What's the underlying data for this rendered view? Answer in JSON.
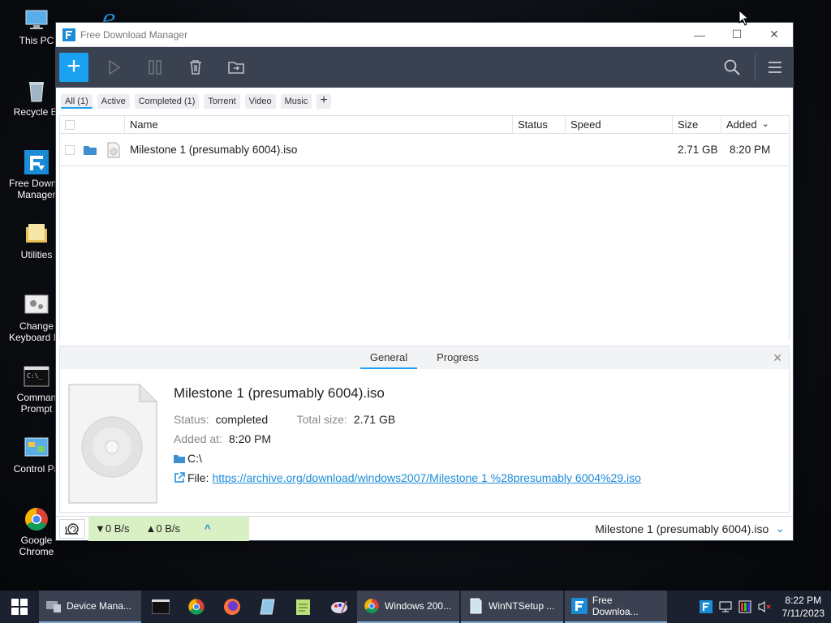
{
  "desktop": {
    "icons": [
      {
        "label": "This PC"
      },
      {
        "label": "Recycle Bi"
      },
      {
        "label": "Free Downlo\nManager"
      },
      {
        "label": "Utilities"
      },
      {
        "label": "Change\nKeyboard La"
      },
      {
        "label": "Comman\nPrompt"
      },
      {
        "label": "Control Pa"
      },
      {
        "label": "Google Chrome"
      }
    ]
  },
  "window": {
    "title": "Free Download Manager",
    "controls": {
      "minimize": "—",
      "maximize": "☐",
      "close": "✕"
    }
  },
  "toolbar": {
    "add": "+"
  },
  "filters": [
    {
      "label": "All (1)",
      "active": true
    },
    {
      "label": "Active"
    },
    {
      "label": "Completed (1)"
    },
    {
      "label": "Torrent"
    },
    {
      "label": "Video"
    },
    {
      "label": "Music"
    },
    {
      "label": "+"
    }
  ],
  "table": {
    "columns": [
      "Name",
      "Status",
      "Speed",
      "Size",
      "Added"
    ],
    "sort_indicator": "⌄",
    "rows": [
      {
        "name": "Milestone 1 (presumably 6004).iso",
        "status": "",
        "speed": "",
        "size": "2.71 GB",
        "added": "8:20 PM"
      }
    ]
  },
  "details": {
    "tabs": [
      "General",
      "Progress"
    ],
    "close": "✕",
    "file_name": "Milestone 1 (presumably 6004).iso",
    "status_label": "Status:",
    "status_value": "completed",
    "total_size_label": "Total size:",
    "total_size_value": "2.71 GB",
    "added_label": "Added at:",
    "added_value": "8:20 PM",
    "folder": "C:\\",
    "file_label": "File:",
    "file_url": "https://archive.org/download/windows2007/Milestone 1 %28presumably 6004%29.iso"
  },
  "statusbar": {
    "down_speed": "▼0 B/s",
    "up_speed": "▲0 B/s",
    "expand": "^",
    "current_file": "Milestone 1 (presumably 6004).iso",
    "dropdown": "⌄"
  },
  "taskbar": {
    "items": [
      {
        "label": "Device Mana..."
      },
      {
        "label": "Windows 200..."
      },
      {
        "label": "WinNTSetup ..."
      },
      {
        "label": "Free Downloa..."
      }
    ],
    "time": "8:22 PM",
    "date": "7/11/2023"
  },
  "colors": {
    "accent": "#1aa1f2",
    "toolbar": "#3a4150",
    "speed_bg": "#d9f0c4"
  }
}
